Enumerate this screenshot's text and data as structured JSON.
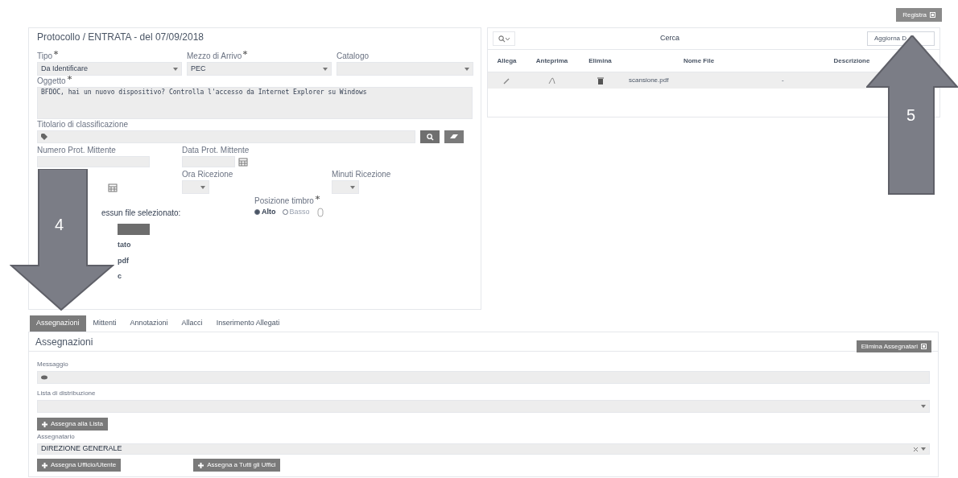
{
  "header": {
    "title": "Protocollo / ENTRATA - del 07/09/2018",
    "register_button": "Registra"
  },
  "form": {
    "tipo": {
      "label": "Tipo",
      "required": true,
      "value": "Da Identificare"
    },
    "mezzo": {
      "label": "Mezzo di Arrivo",
      "required": true,
      "value": "PEC"
    },
    "catalogo": {
      "label": "Catalogo"
    },
    "oggetto": {
      "label": "Oggetto",
      "required": true,
      "value": "BFDOC, hai un nuovo dispositivo? Controlla l'accesso da Internet Explorer su Windows"
    },
    "titolario": {
      "label": "Titolario di classificazione"
    },
    "numero_prot": {
      "label": "Numero Prot. Mittente"
    },
    "data_prot": {
      "label": "Data Prot. Mittente"
    },
    "ora": {
      "label": "Ora Ricezione"
    },
    "minuti": {
      "label": "Minuti Ricezione"
    },
    "posizione": {
      "label": "Posizione timbro",
      "required": true,
      "options": [
        {
          "label": "Alto",
          "selected": true
        },
        {
          "label": "Basso",
          "selected": false
        }
      ]
    },
    "file_status": "essun file selezionato:",
    "fragments": [
      "tato",
      "pdf",
      "c"
    ]
  },
  "files": {
    "search_button": "Cerca",
    "refresh_button": "Aggiorna D",
    "columns": [
      "Allega",
      "Anteprima",
      "Elimina",
      "Nome File",
      "Descrizione"
    ],
    "rows": [
      {
        "name": "scansione.pdf",
        "description": "-"
      }
    ]
  },
  "tabs": [
    {
      "label": "Assegnazioni",
      "selected": true
    },
    {
      "label": "Mittenti",
      "selected": false
    },
    {
      "label": "Annotazioni",
      "selected": false
    },
    {
      "label": "Allacci",
      "selected": false
    },
    {
      "label": "Inserimento Allegati",
      "selected": false
    }
  ],
  "assegnazioni": {
    "title": "Assegnazioni",
    "delete_button": "Elimina Assegnatari",
    "messaggio_label": "Messaggio",
    "lista_label": "Lista di distribuzione",
    "lista_button": "Assegna alla Lista",
    "assegnatario_label": "Assegnatario",
    "assegnatario_value": "DIREZIONE GENERALE",
    "ufficio_button": "Assegna Ufficio/Utente",
    "tutti_button": "Assegna a Tutti gli Uffici"
  },
  "callouts": [
    {
      "number": "4",
      "kind": "down"
    },
    {
      "number": "5",
      "kind": "up"
    }
  ]
}
